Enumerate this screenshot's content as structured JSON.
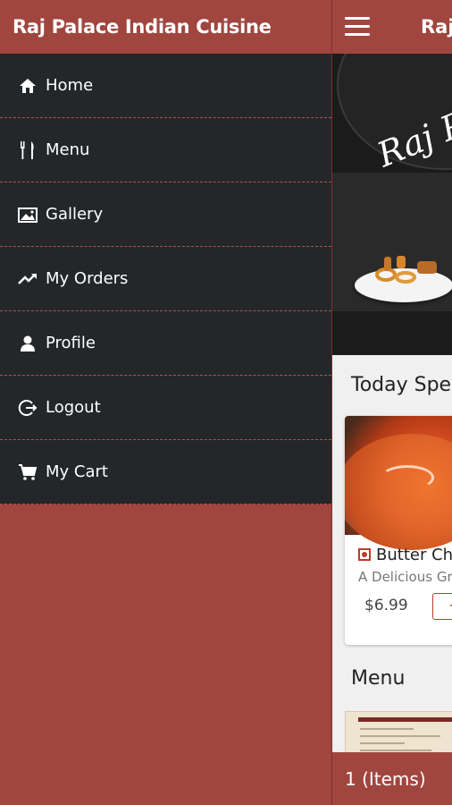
{
  "drawer": {
    "title": "Raj Palace Indian Cuisine",
    "items": [
      {
        "label": "Home",
        "icon": "home-icon"
      },
      {
        "label": "Menu",
        "icon": "fork-knife-icon"
      },
      {
        "label": "Gallery",
        "icon": "gallery-icon"
      },
      {
        "label": "My Orders",
        "icon": "trending-up-icon"
      },
      {
        "label": "Profile",
        "icon": "person-icon"
      },
      {
        "label": "Logout",
        "icon": "logout-icon"
      },
      {
        "label": "My Cart",
        "icon": "cart-icon"
      }
    ]
  },
  "main": {
    "title": "Raj",
    "banner_script": "Raj Pa",
    "today_special_title": "Today Spec",
    "special_item": {
      "name": "Butter Chic",
      "description": "A Delicious Gra",
      "price": "$6.99",
      "add_label": "+"
    },
    "menu_title": "Menu",
    "cart_label": "1 (Items)"
  },
  "colors": {
    "brand": "#a0463f",
    "drawer_bg": "#23272a",
    "accent_red": "#c0392b"
  }
}
